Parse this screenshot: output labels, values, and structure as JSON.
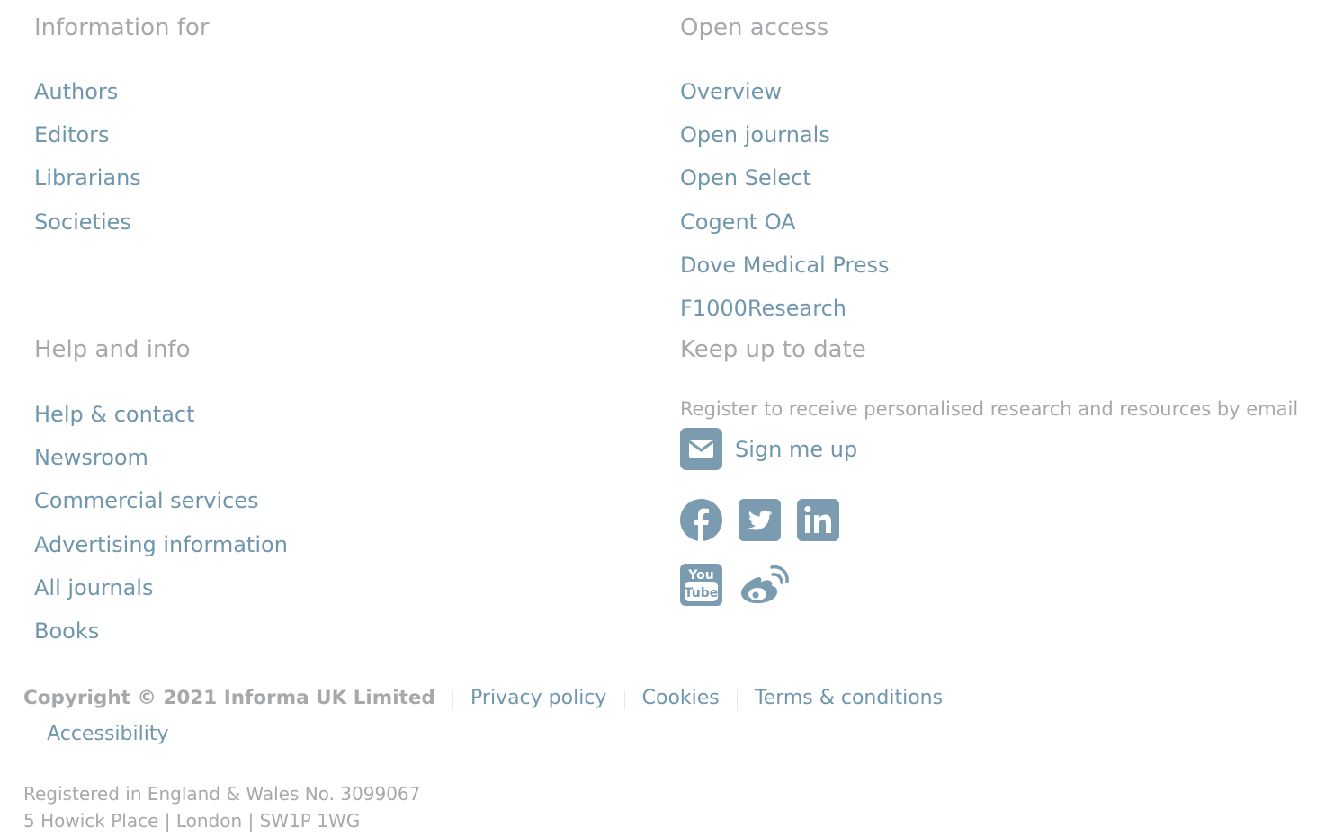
{
  "info_for": {
    "heading": "Information for",
    "links": [
      "Authors",
      "Editors",
      "Librarians",
      "Societies"
    ]
  },
  "open_access": {
    "heading": "Open access",
    "links": [
      "Overview",
      "Open journals",
      "Open Select",
      "Cogent OA",
      "Dove Medical Press",
      "F1000Research"
    ]
  },
  "help_info": {
    "heading": "Help and info",
    "links": [
      "Help & contact",
      "Newsroom",
      "Commercial services",
      "Advertising information",
      "All journals",
      "Books"
    ]
  },
  "keep_up": {
    "heading": "Keep up to date",
    "register_text": "Register to receive personalised research and resources by email",
    "signup_label": "Sign me up",
    "signup_icon": "envelope-icon",
    "social_icons": [
      "facebook-icon",
      "twitter-icon",
      "linkedin-icon",
      "youtube-icon",
      "weibo-icon"
    ]
  },
  "footer": {
    "copyright": "Copyright © 2021 Informa UK Limited",
    "links": [
      "Privacy policy",
      "Cookies",
      "Terms & conditions",
      "Accessibility"
    ],
    "address_line1": "Registered in England & Wales No. 3099067",
    "address_line2": "5 Howick Place | London | SW1P 1WG"
  },
  "colors": {
    "link": "#6f96ad",
    "heading": "#a5a9ac",
    "icon": "#7a9bb0"
  }
}
